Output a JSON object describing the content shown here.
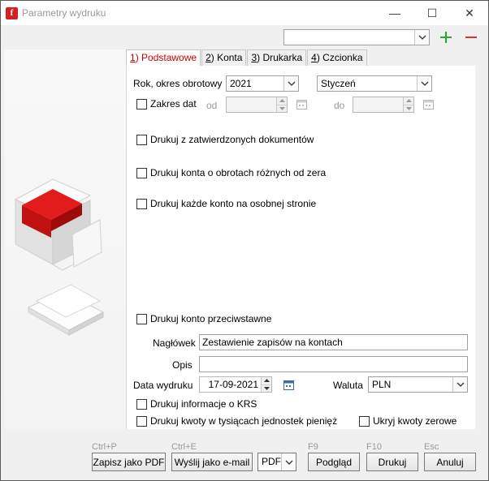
{
  "window": {
    "title": "Parametry wydruku",
    "app_icon_glyph": "f",
    "controls": {
      "minimize": "—",
      "maximize": "☐",
      "close": "✕"
    }
  },
  "profile": {
    "value": "",
    "add_icon": "plus-icon",
    "remove_icon": "minus-icon"
  },
  "tabs": [
    {
      "key": "1",
      "label": ") Podstawowe",
      "active": true
    },
    {
      "key": "2",
      "label": ") Konta",
      "active": false
    },
    {
      "key": "3",
      "label": ") Drukarka",
      "active": false
    },
    {
      "key": "4",
      "label": ") Czcionka",
      "active": false
    }
  ],
  "form": {
    "rok_label": "Rok, okres obrotowy",
    "rok_value": "2021",
    "miesiac_value": "Styczeń",
    "zakres_label": "Zakres dat",
    "od_label": "od",
    "do_label": "do",
    "od_value": "",
    "do_value": "",
    "cb_zatwierdzone": "Drukuj z zatwierdzonych dokumentów",
    "cb_obroty": "Drukuj konta o obrotach różnych od zera",
    "cb_osobna": "Drukuj każde konto na osobnej stronie",
    "cb_przeciwstawne": "Drukuj konto przeciwstawne",
    "naglowek_label": "Nagłówek",
    "naglowek_value": "Zestawienie zapisów na kontach",
    "opis_label": "Opis",
    "opis_value": "",
    "data_label": "Data wydruku",
    "data_value": "17-09-2021",
    "waluta_label": "Waluta",
    "waluta_value": "PLN",
    "cb_krs": "Drukuj informacje o KRS",
    "cb_tysiace": "Drukuj kwoty w tysiącach jednostek pieniężnych",
    "cb_zerowe": "Ukryj kwoty zerowe"
  },
  "footer": {
    "pdf_shortcut": "Ctrl+P",
    "pdf_label": "Zapisz jako PDF",
    "email_shortcut": "Ctrl+E",
    "email_label": "Wyślij jako e-mail",
    "format_value": "PDF",
    "preview_shortcut": "F9",
    "preview_label": "Podgląd",
    "print_shortcut": "F10",
    "print_label": "Drukuj",
    "cancel_shortcut": "Esc",
    "cancel_label": "Anuluj"
  },
  "colors": {
    "accent_red": "#e02020",
    "add_green": "#2fa52f",
    "remove_red": "#e03030"
  }
}
